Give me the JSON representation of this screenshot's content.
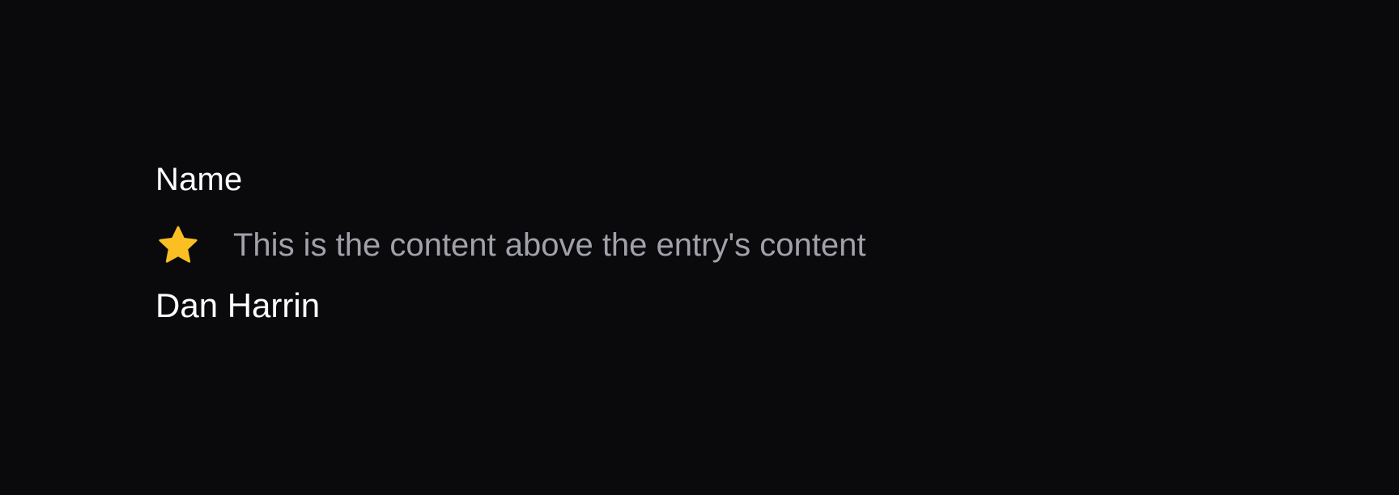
{
  "entry": {
    "label": "Name",
    "above_content": {
      "icon": "star-icon",
      "icon_color": "#fbbf24",
      "text": "This is the content above the entry's content"
    },
    "value": "Dan Harrin"
  },
  "colors": {
    "background": "#0a0a0c",
    "label": "#ffffff",
    "muted_text": "#a1a1aa",
    "value": "#ffffff",
    "accent": "#fbbf24"
  }
}
